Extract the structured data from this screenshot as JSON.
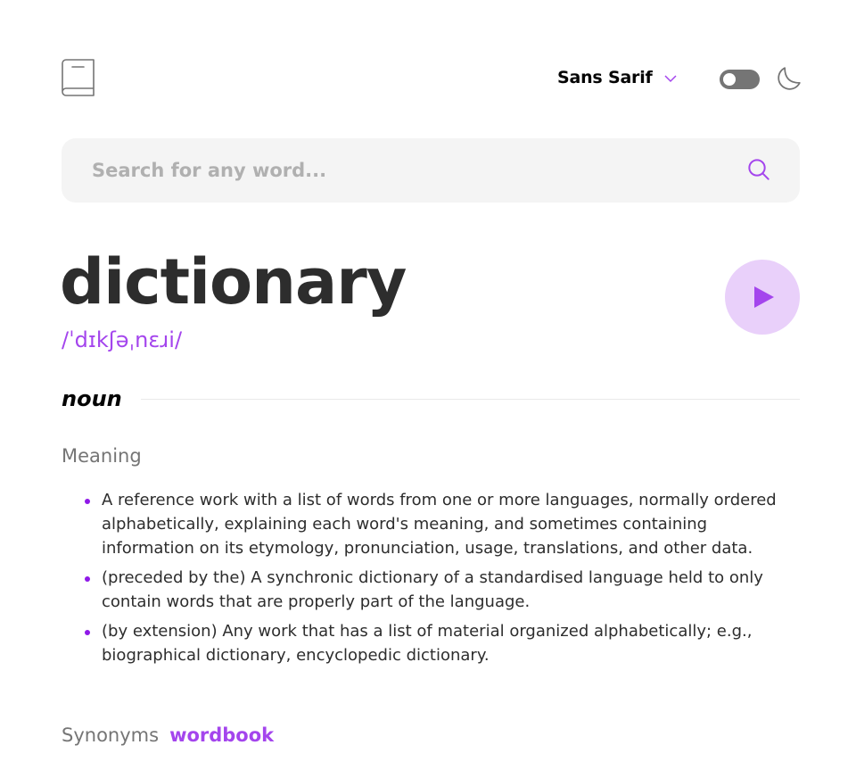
{
  "header": {
    "logo_icon": "book-icon",
    "font_selector": {
      "selected": "Sans Sarif",
      "icon": "chevron-down-icon"
    },
    "theme_toggle": {
      "state": "off",
      "icon": "moon-icon"
    }
  },
  "search": {
    "placeholder": "Search for any word...",
    "value": "",
    "icon": "search-icon"
  },
  "entry": {
    "word": "dictionary",
    "phonetic": "/ˈdɪkʃəˌnɛɹi/",
    "play_icon": "play-icon",
    "part_of_speech": "noun",
    "meaning_heading": "Meaning",
    "definitions": [
      "A reference work with a list of words from one or more languages, normally ordered alphabetically, explaining each word's meaning, and sometimes containing information on its etymology, pronunciation, usage, translations, and other data.",
      "(preceded by the) A synchronic dictionary of a standardised language held to only contain words that are properly part of the language.",
      "(by extension) Any work that has a list of material organized alphabetically; e.g., biographical dictionary, encyclopedic dictionary."
    ],
    "synonyms_label": "Synonyms",
    "synonyms": [
      "wordbook"
    ]
  },
  "colors": {
    "accent": "#a445ed",
    "bullet": "#8f19e8",
    "play_bg": "#e9d0fa",
    "text": "#2d2d2d",
    "muted": "#757575",
    "search_bg": "#f4f4f4"
  }
}
